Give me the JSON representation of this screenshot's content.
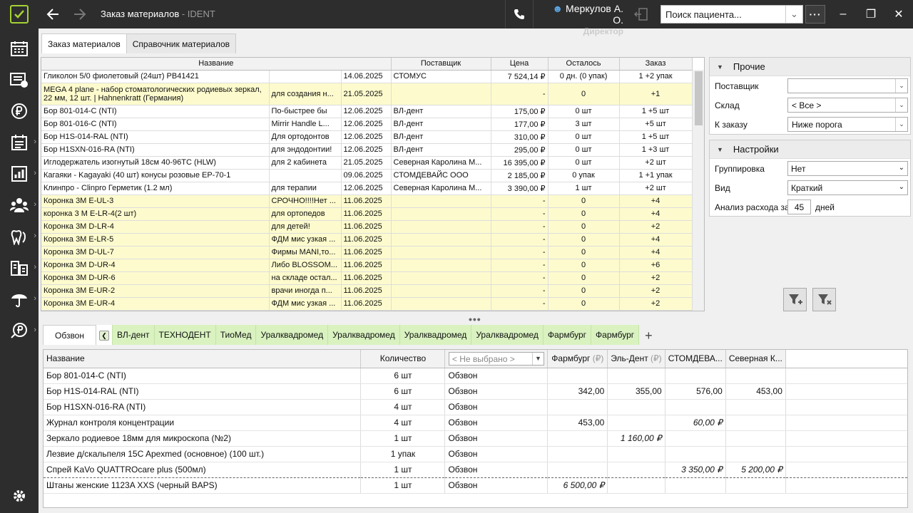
{
  "window": {
    "title": "Заказ материалов",
    "app_name": " - IDENT",
    "user_name": "Меркулов А. О.",
    "user_role": "Директор",
    "search_placeholder": "Поиск пациента..."
  },
  "top_tabs": [
    "Заказ материалов",
    "Справочник материалов"
  ],
  "materials_table": {
    "columns": [
      "Название",
      "Поставщик",
      "Цена",
      "Осталось",
      "Заказ"
    ],
    "rows": [
      {
        "name": "Гликолон 5/0 фиолетовый (24шт) PB41421",
        "comment": "",
        "date": "14.06.2025",
        "supplier": "СТОМУС",
        "price": "7 524,14 ₽",
        "left": "0 дн. (0 упак)",
        "order": "1 +2 упак",
        "yellow": false
      },
      {
        "name": "MEGA 4 plane - набор стоматологических родиевых зеркал, 22 мм, 12 шт. | Hahnenkratt (Германия)",
        "comment": "для создания н...",
        "date": "21.05.2025",
        "supplier": "",
        "price": "-",
        "left": "0",
        "order": "+1",
        "yellow": true
      },
      {
        "name": "Бор 801-014-С (NTI)",
        "comment": "По-быстрее бы",
        "date": "12.06.2025",
        "supplier": "ВЛ-дент",
        "price": "175,00 ₽",
        "left": "0 шт",
        "order": "1 +5 шт",
        "yellow": false
      },
      {
        "name": "Бор 801-016-С (NTI)",
        "comment": "Mirrir Handle L...",
        "date": "12.06.2025",
        "supplier": "ВЛ-дент",
        "price": "177,00 ₽",
        "left": "3 шт",
        "order": "+5 шт",
        "yellow": false
      },
      {
        "name": "Бор H1S-014-RAL (NTI)",
        "comment": "Для ортодонтов",
        "date": "12.06.2025",
        "supplier": "ВЛ-дент",
        "price": "310,00 ₽",
        "left": "0 шт",
        "order": "1 +5 шт",
        "yellow": false
      },
      {
        "name": "Бор H1SXN-016-RA (NTI)",
        "comment": "для эндодонтии!",
        "date": "12.06.2025",
        "supplier": "ВЛ-дент",
        "price": "295,00 ₽",
        "left": "0 шт",
        "order": "1 +3 шт",
        "yellow": false
      },
      {
        "name": "Иглодержатель изогнутый 18см 40-96TC (HLW)",
        "comment": "для 2 кабинета",
        "date": "21.05.2025",
        "supplier": "Северная Каролина М...",
        "price": "16 395,00 ₽",
        "left": "0 шт",
        "order": "+2 шт",
        "yellow": false
      },
      {
        "name": "Кагаяки - Kagayaki (40 шт) конусы розовые EP-70-1",
        "comment": "",
        "date": "09.06.2025",
        "supplier": "СТОМДЕВАЙС ООО",
        "price": "2 185,00 ₽",
        "left": "0 упак",
        "order": "1 +1 упак",
        "yellow": false
      },
      {
        "name": "Клинпро  -  Clinpro  Герметик (1.2 мл)",
        "comment": "для терапии",
        "date": "12.06.2025",
        "supplier": "Северная Каролина М...",
        "price": "3 390,00 ₽",
        "left": "1 шт",
        "order": "+2 шт",
        "yellow": false
      },
      {
        "name": "Коронка  3M E-UL-3",
        "comment": "СРОЧНО!!!!Нет ...",
        "date": "11.06.2025",
        "supplier": "",
        "price": "-",
        "left": "0",
        "order": "+4",
        "yellow": true
      },
      {
        "name": "коронка 3 M E-LR-4(2 шт)",
        "comment": "для ортопедов",
        "date": "11.06.2025",
        "supplier": "",
        "price": "-",
        "left": "0",
        "order": "+4",
        "yellow": true
      },
      {
        "name": "Коронка 3M D-LR-4",
        "comment": "для детей!",
        "date": "11.06.2025",
        "supplier": "",
        "price": "-",
        "left": "0",
        "order": "+2",
        "yellow": true
      },
      {
        "name": "Коронка 3M E-LR-5",
        "comment": "ФДМ мис узкая ...",
        "date": "11.06.2025",
        "supplier": "",
        "price": "-",
        "left": "0",
        "order": "+4",
        "yellow": true
      },
      {
        "name": "Коронка 3M D-UL-7",
        "comment": "Фирмы MANI,то...",
        "date": "11.06.2025",
        "supplier": "",
        "price": "-",
        "left": "0",
        "order": "+4",
        "yellow": true
      },
      {
        "name": "Коронка 3M D-UR-4",
        "comment": "Либо BLOSSOM...",
        "date": "11.06.2025",
        "supplier": "",
        "price": "-",
        "left": "0",
        "order": "+6",
        "yellow": true
      },
      {
        "name": "Коронка 3M D-UR-6",
        "comment": "на складе остал...",
        "date": "11.06.2025",
        "supplier": "",
        "price": "-",
        "left": "0",
        "order": "+2",
        "yellow": true
      },
      {
        "name": "Коронка 3M E-UR-2",
        "comment": "врачи иногда п...",
        "date": "11.06.2025",
        "supplier": "",
        "price": "-",
        "left": "0",
        "order": "+2",
        "yellow": true
      },
      {
        "name": "Коронка 3M E-UR-4",
        "comment": "ФДМ мис узкая ...",
        "date": "11.06.2025",
        "supplier": "",
        "price": "-",
        "left": "0",
        "order": "+2",
        "yellow": true
      }
    ]
  },
  "filters": {
    "other": {
      "title": "Прочие",
      "supplier_label": "Поставщик",
      "supplier_value": "",
      "warehouse_label": "Склад",
      "warehouse_value": "< Все >",
      "to_order_label": "К заказу",
      "to_order_value": "Ниже порога"
    },
    "settings": {
      "title": "Настройки",
      "grouping_label": "Группировка",
      "grouping_value": "Нет",
      "view_label": "Вид",
      "view_value": "Краткий",
      "analysis_label": "Анализ расхода за",
      "analysis_value": "45",
      "analysis_unit": "дней"
    }
  },
  "bottom_tabs": [
    "Обзвон",
    "ВЛ-дент",
    "ТЕХНОДЕНТ",
    "ТиоМед",
    "Уралквадромед",
    "Уралквадромед",
    "Уралквадромед",
    "Уралквадромед",
    "Фармбург",
    "Фармбург"
  ],
  "order_table": {
    "col_name": "Название",
    "col_qty": "Количество",
    "col_select": "< Не выбрано >",
    "col_farmburg": "Фармбург",
    "col_eldent": "Эль-Дент",
    "col_stomdev": "СТОМДЕВА...",
    "col_sever": "Северная К...",
    "rub": "(₽)",
    "rows": [
      {
        "name": "Бор 801-014-С (NTI)",
        "qty": "6 шт",
        "status": "Обзвон",
        "farmburg": "",
        "eldent": "",
        "stomdev": "",
        "sever": ""
      },
      {
        "name": "Бор H1S-014-RAL (NTI)",
        "qty": "6 шт",
        "status": "Обзвон",
        "farmburg": "342,00",
        "eldent": "355,00",
        "stomdev": "576,00",
        "sever": "453,00"
      },
      {
        "name": "Бор H1SXN-016-RA (NTI)",
        "qty": "4 шт",
        "status": "Обзвон",
        "farmburg": "",
        "eldent": "",
        "stomdev": "",
        "sever": ""
      },
      {
        "name": "Журнал контроля концентрации",
        "qty": "4 шт",
        "status": "Обзвон",
        "farmburg": "453,00",
        "eldent": "",
        "stomdev": "60,00 ₽",
        "sever": ""
      },
      {
        "name": "Зеркало родиевое 18мм для микроскопа (№2)",
        "qty": "1 шт",
        "status": "Обзвон",
        "farmburg": "",
        "eldent": "1 160,00 ₽",
        "stomdev": "",
        "sever": ""
      },
      {
        "name": "Лезвие д/скальпеля 15C Apexmed (основное) (100 шт.)",
        "qty": "1 упак",
        "status": "Обзвон",
        "farmburg": "",
        "eldent": "",
        "stomdev": "",
        "sever": ""
      },
      {
        "name": "Спрей KaVo QUATTROcare plus (500мл)",
        "qty": "1 шт",
        "status": "Обзвон",
        "farmburg": "",
        "eldent": "",
        "stomdev": "3 350,00 ₽",
        "sever": "5 200,00 ₽"
      },
      {
        "name": "Штаны женские 1123A XXS (черный BAPS)",
        "qty": "1 шт",
        "status": "Обзвон",
        "farmburg": "6 500,00 ₽",
        "eldent": "",
        "stomdev": "",
        "sever": ""
      }
    ]
  },
  "colors": {
    "accent": "#a4d233",
    "titlebar": "#2d2d2d",
    "highlight_row": "#fdfbcd",
    "supplier_tab": "#d9f2c0"
  }
}
